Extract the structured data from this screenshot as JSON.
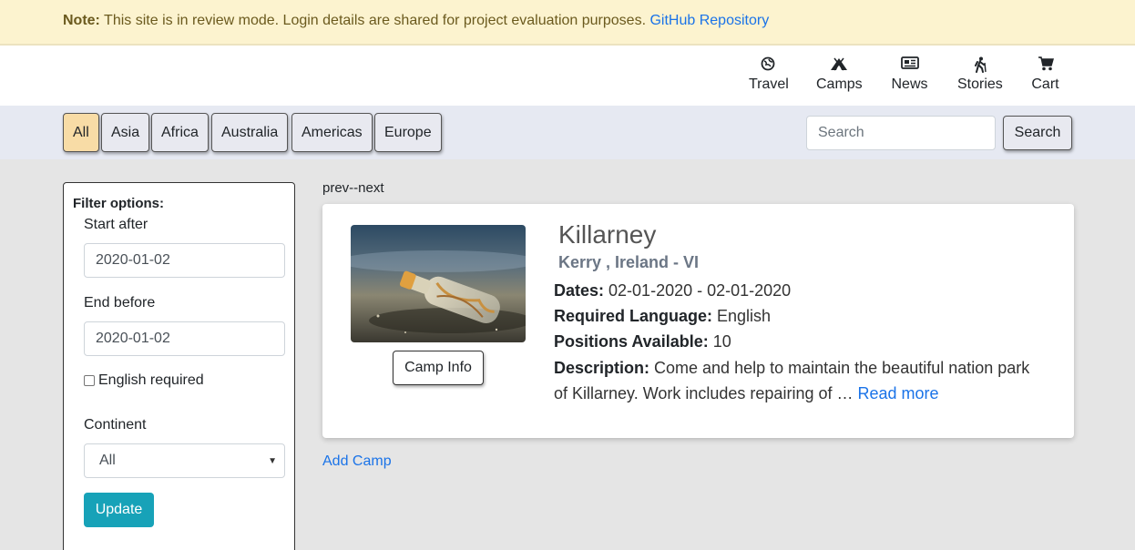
{
  "notice": {
    "label": "Note:",
    "text": " This site is in review mode. Login details are shared for project evaluation purposes. ",
    "link": "GitHub Repository"
  },
  "nav": {
    "items": [
      {
        "label": "Travel",
        "icon": "globe-icon"
      },
      {
        "label": "Camps",
        "icon": "tent-icon"
      },
      {
        "label": "News",
        "icon": "newspaper-icon"
      },
      {
        "label": "Stories",
        "icon": "hiker-icon"
      },
      {
        "label": "Cart",
        "icon": "cart-icon"
      }
    ]
  },
  "categories": [
    "All",
    "Asia",
    "Africa",
    "Australia",
    "Americas",
    "Europe"
  ],
  "active_category": "All",
  "search": {
    "placeholder": "Search",
    "button": "Search"
  },
  "filter": {
    "title": "Filter options:",
    "start_label": "Start after",
    "start_value": "2020-01-02",
    "end_label": "End before",
    "end_value": "2020-01-02",
    "english_label": "English required",
    "continent_label": "Continent",
    "continent_value": "All",
    "update": "Update"
  },
  "pager": "prev--next",
  "camp": {
    "title": "Killarney",
    "subtitle": "Kerry , Ireland - VI",
    "dates_label": "Dates:",
    "dates_value": " 02-01-2020 - 02-01-2020",
    "lang_label": "Required Language:",
    "lang_value": " English",
    "positions_label": "Positions Available:",
    "positions_value": " 10",
    "desc_label": "Description:",
    "desc_value": " Come and help to maintain the beautiful nation park of Killarney. Work includes repairing of … ",
    "read_more": "Read more",
    "info_button": "Camp Info"
  },
  "add_camp": "Add Camp"
}
